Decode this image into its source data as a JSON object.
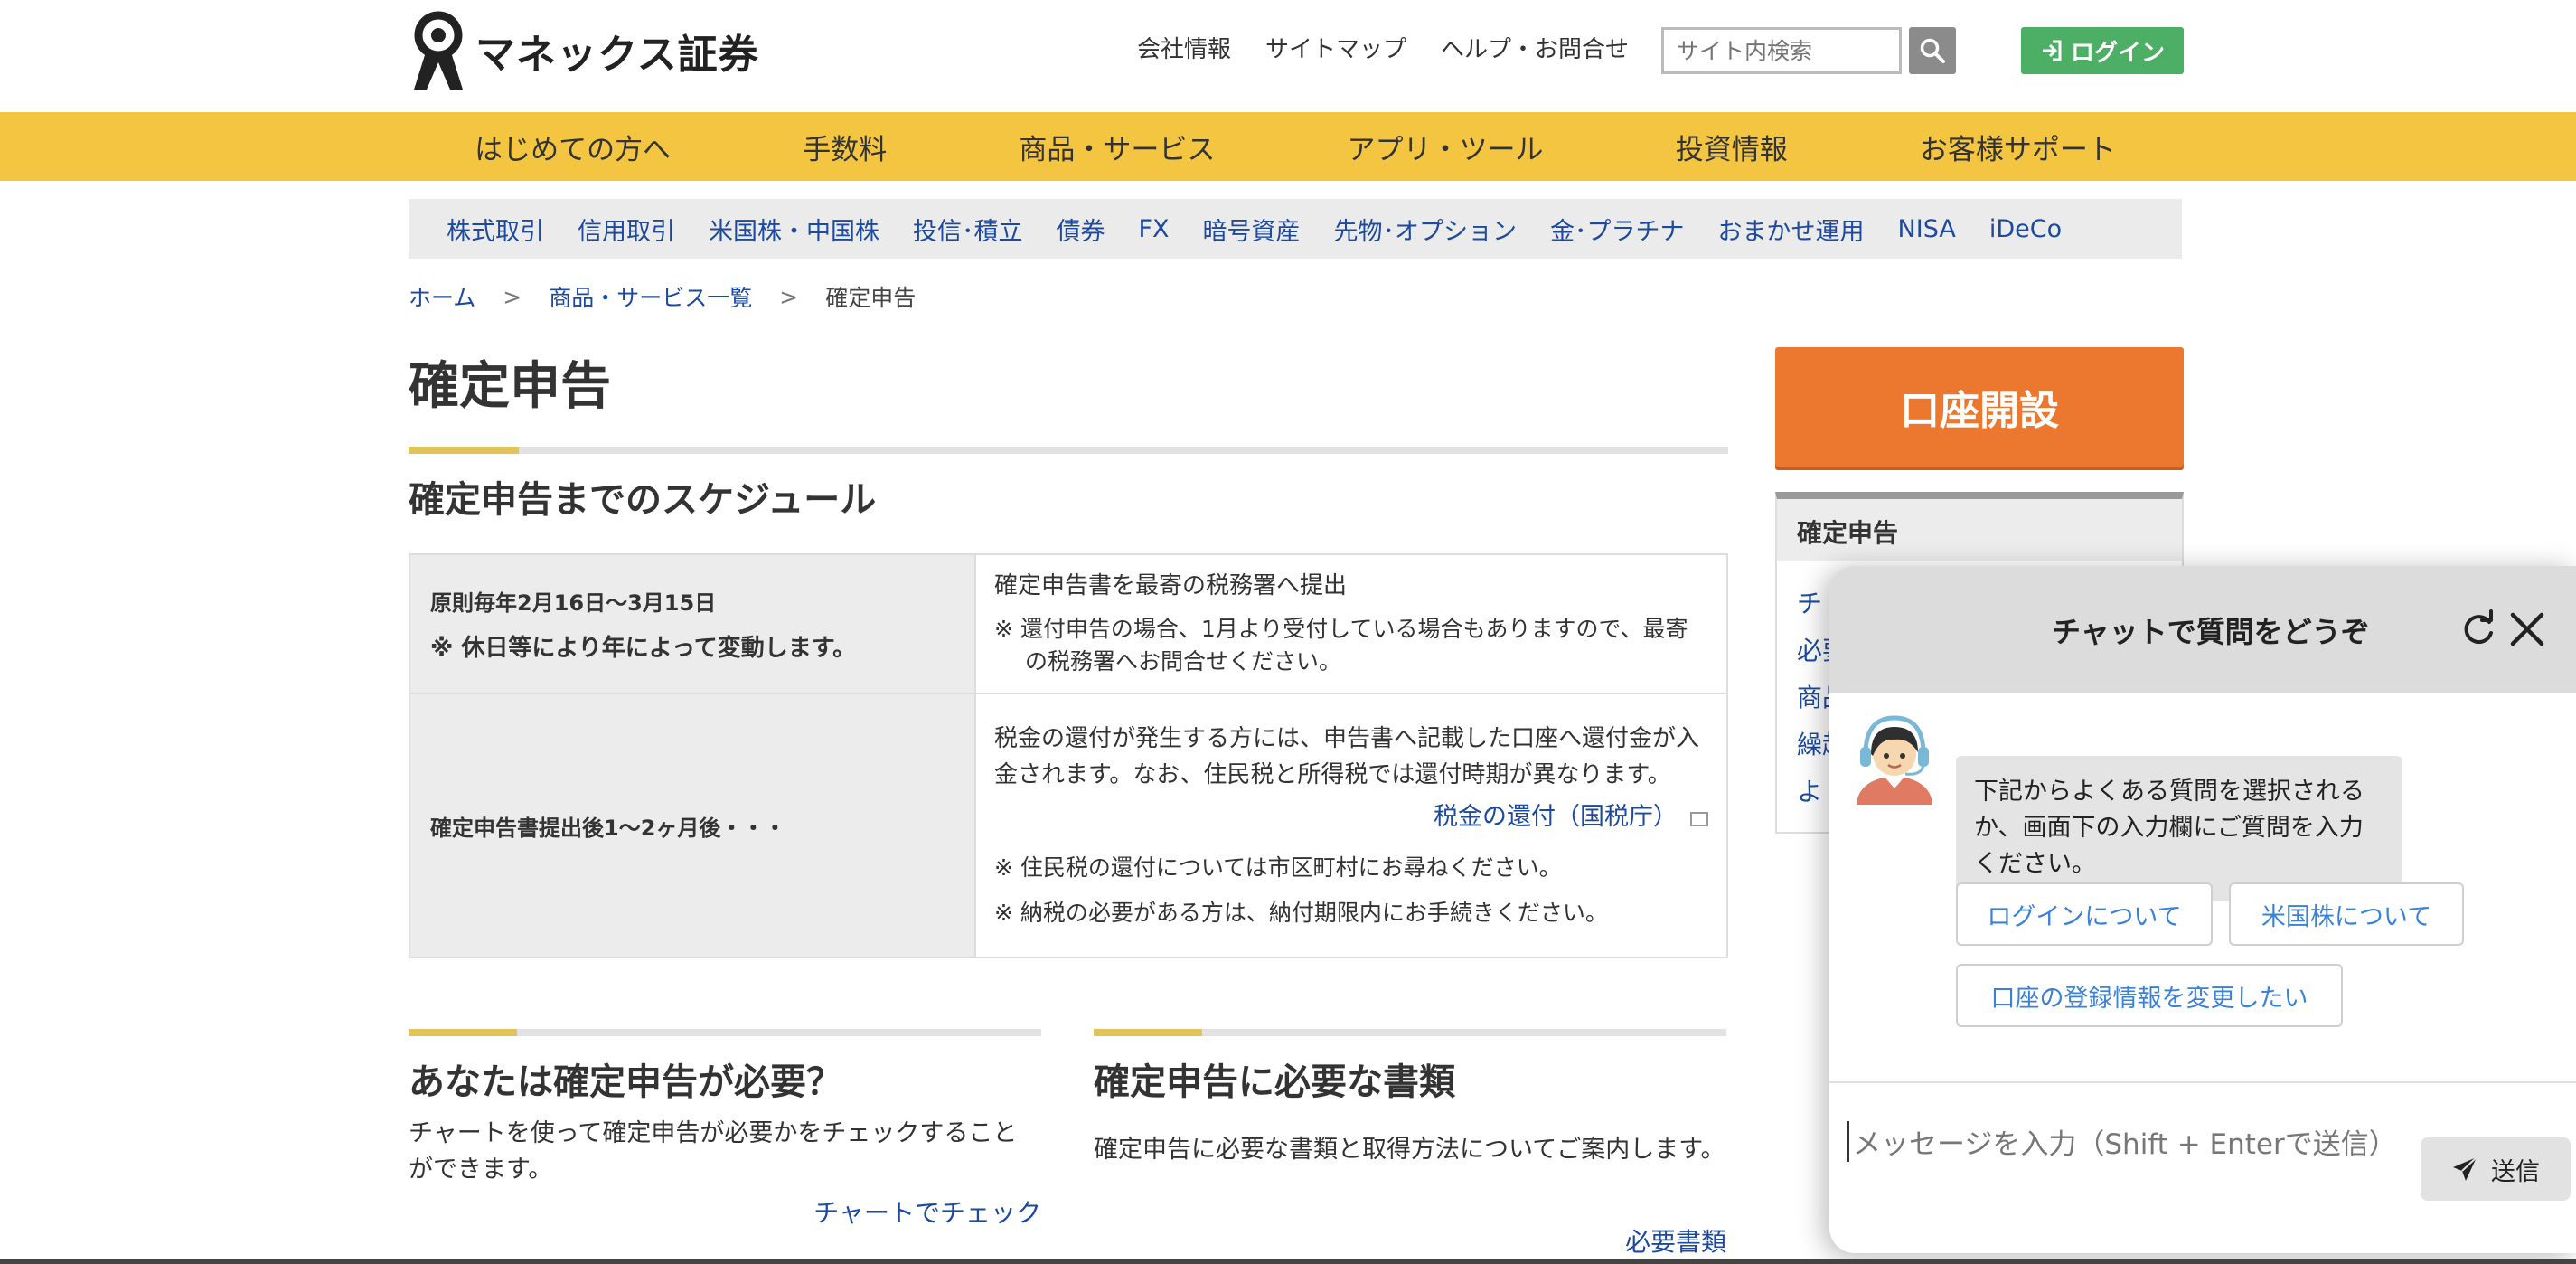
{
  "header": {
    "logo_text": "マネックス証券",
    "util_links": [
      "会社情報",
      "サイトマップ",
      "ヘルプ・お問合せ"
    ],
    "search_placeholder": "サイト内検索",
    "login_label": "ログイン"
  },
  "main_nav": [
    "はじめての方へ",
    "手数料",
    "商品・サービス",
    "アプリ・ツール",
    "投資情報",
    "お客様サポート"
  ],
  "sub_nav": [
    "株式取引",
    "信用取引",
    "米国株・中国株",
    "投信･積立",
    "債券",
    "FX",
    "暗号資産",
    "先物･オプション",
    "金･プラチナ",
    "おまかせ運用",
    "NISA",
    "iDeCo"
  ],
  "breadcrumb": {
    "home": "ホーム",
    "sep": ">",
    "level2": "商品・サービス一覧",
    "current": "確定申告"
  },
  "page_title": "確定申告",
  "section_title": "確定申告までのスケジュール",
  "schedule": {
    "row1": {
      "when": "原則毎年2月16日～3月15日",
      "when_note": "※ 休日等により年によって変動します。",
      "what": "確定申告書を最寄の税務署へ提出",
      "note": "※ 還付申告の場合、1月より受付している場合もありますので、最寄の税務署へお問合せください。"
    },
    "row2": {
      "when": "確定申告書提出後1～2ヶ月後・・・",
      "what": "税金の還付が発生する方には、申告書へ記載した口座へ還付金が入金されます。なお、住民税と所得税では還付時期が異なります。",
      "link": "税金の還付（国税庁）",
      "note1": "※ 住民税の還付については市区町村にお尋ねください。",
      "note2": "※ 納税の必要がある方は、納付期限内にお手続きください。"
    }
  },
  "cards": {
    "left": {
      "title": "あなたは確定申告が必要？",
      "text": "チャートを使って確定申告が必要かをチェックすることができます。",
      "link": "チャートでチェック"
    },
    "right": {
      "title": "確定申告に必要な書類",
      "text": "確定申告に必要な書類と取得方法についてご案内します。",
      "link": "必要書類"
    }
  },
  "sidebar": {
    "open_account": "口座開設",
    "box_title": "確定申告",
    "items": [
      "チ",
      "必要",
      "商品",
      "繰越",
      "よ"
    ]
  },
  "chat": {
    "title": "チャットで質問をどうぞ",
    "message": "下記からよくある質問を選択されるか、画面下の入力欄にご質問を入力ください。",
    "quick": [
      "ログインについて",
      "米国株について",
      "口座の登録情報を変更したい"
    ],
    "input_placeholder": "メッセージを入力（Shift + Enterで送信）",
    "send_label": "送信"
  },
  "colors": {
    "nav_yellow": "#f3c541",
    "accent_orange": "#ec7830",
    "login_green": "#4caf65",
    "link_blue": "#1d4a9e",
    "chat_link_blue": "#3b82d6"
  }
}
